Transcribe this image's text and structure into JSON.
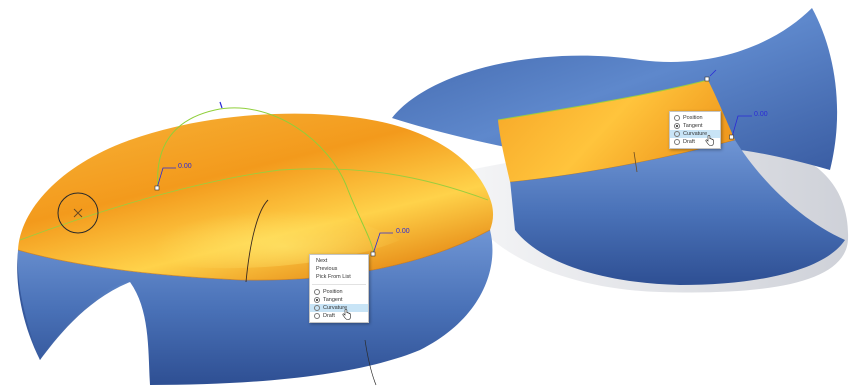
{
  "colors": {
    "surface_orange": "#f2a020",
    "surface_highlight": "#ffd040",
    "surface_blue": "#4a72b8",
    "dimension_blue": "#2b2bd6",
    "guide_green": "#8fcf3a",
    "menu_selected": "#c8e4f6"
  },
  "left_view": {
    "dimensions": [
      {
        "value": "0.00"
      },
      {
        "value": "0.00"
      }
    ],
    "menu": {
      "actions": [
        "Next",
        "Previous",
        "Pick From List"
      ],
      "options": [
        {
          "label": "Position",
          "checked": false,
          "highlighted": false
        },
        {
          "label": "Tangent",
          "checked": true,
          "highlighted": false
        },
        {
          "label": "Curvature",
          "checked": false,
          "highlighted": true
        },
        {
          "label": "Draft",
          "checked": false,
          "highlighted": false
        }
      ]
    }
  },
  "right_view": {
    "dimensions": [
      {
        "value": "0.00"
      }
    ],
    "menu": {
      "options": [
        {
          "label": "Position",
          "checked": false,
          "highlighted": false
        },
        {
          "label": "Tangent",
          "checked": true,
          "highlighted": false
        },
        {
          "label": "Curvature",
          "checked": false,
          "highlighted": true
        },
        {
          "label": "Draft",
          "checked": false,
          "highlighted": false
        }
      ]
    }
  },
  "icons": [
    "hand-cursor-icon",
    "edge-pick-circle-icon",
    "end-marker-icon"
  ]
}
